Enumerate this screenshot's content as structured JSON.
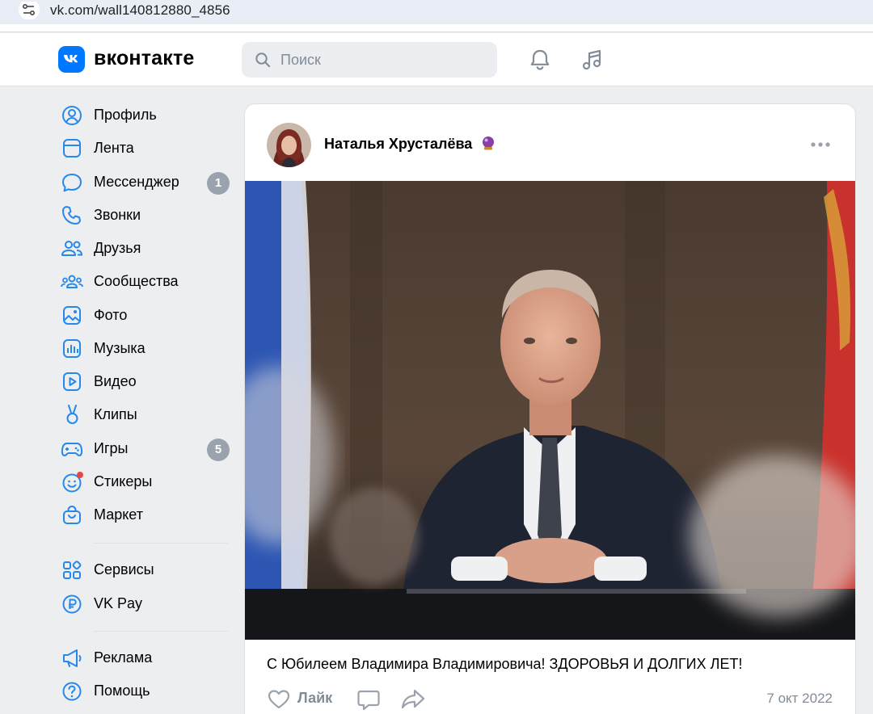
{
  "browser": {
    "url": "vk.com/wall140812880_4856"
  },
  "header": {
    "logo_text": "вконтакте",
    "search_placeholder": "Поиск",
    "brand_color": "#0077ff"
  },
  "sidebar": {
    "items": [
      {
        "label": "Профиль",
        "icon": "user-circle-icon"
      },
      {
        "label": "Лента",
        "icon": "feed-icon"
      },
      {
        "label": "Мессенджер",
        "icon": "message-icon",
        "badge": "1"
      },
      {
        "label": "Звонки",
        "icon": "phone-icon"
      },
      {
        "label": "Друзья",
        "icon": "friends-icon"
      },
      {
        "label": "Сообщества",
        "icon": "community-icon"
      },
      {
        "label": "Фото",
        "icon": "photo-icon"
      },
      {
        "label": "Музыка",
        "icon": "music-icon"
      },
      {
        "label": "Видео",
        "icon": "video-icon"
      },
      {
        "label": "Клипы",
        "icon": "clips-icon"
      },
      {
        "label": "Игры",
        "icon": "gamepad-icon",
        "badge": "5"
      },
      {
        "label": "Стикеры",
        "icon": "smile-icon"
      },
      {
        "label": "Маркет",
        "icon": "shopping-bag-icon"
      },
      {
        "label": "Сервисы",
        "icon": "services-icon"
      },
      {
        "label": "VK Pay",
        "icon": "ruble-icon"
      },
      {
        "label": "Реклама",
        "icon": "megaphone-icon"
      },
      {
        "label": "Помощь",
        "icon": "help-icon"
      }
    ]
  },
  "post": {
    "author": "Наталья Хрусталёва",
    "text": "С Юбилеем Владимира Владимировича! ЗДОРОВЬЯ И ДОЛГИХ ЛЕТ!",
    "like_label": "Лайк",
    "date": "7 окт 2022"
  }
}
